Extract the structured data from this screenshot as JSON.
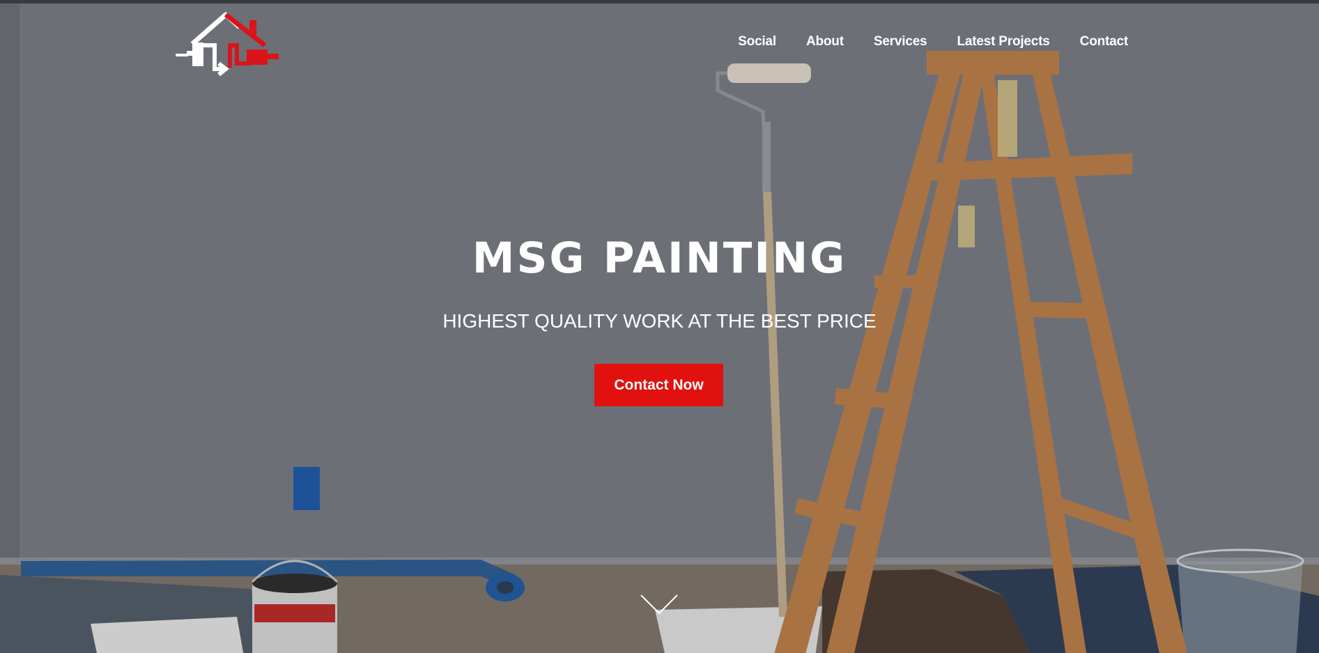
{
  "header": {
    "logo_icon": "house-paint-roller-logo-icon",
    "nav": [
      "Social",
      "About",
      "Services",
      "Latest Projects",
      "Contact"
    ]
  },
  "hero": {
    "title": "MSG PAINTING",
    "subtitle": "HIGHEST QUALITY WORK AT THE BEST PRICE",
    "cta_label": "Contact Now",
    "scroll_icon": "chevron-down-icon"
  },
  "colors": {
    "accent": "#e0110f",
    "text": "#ffffff",
    "logo_red": "#d9141a",
    "logo_white": "#ffffff"
  }
}
